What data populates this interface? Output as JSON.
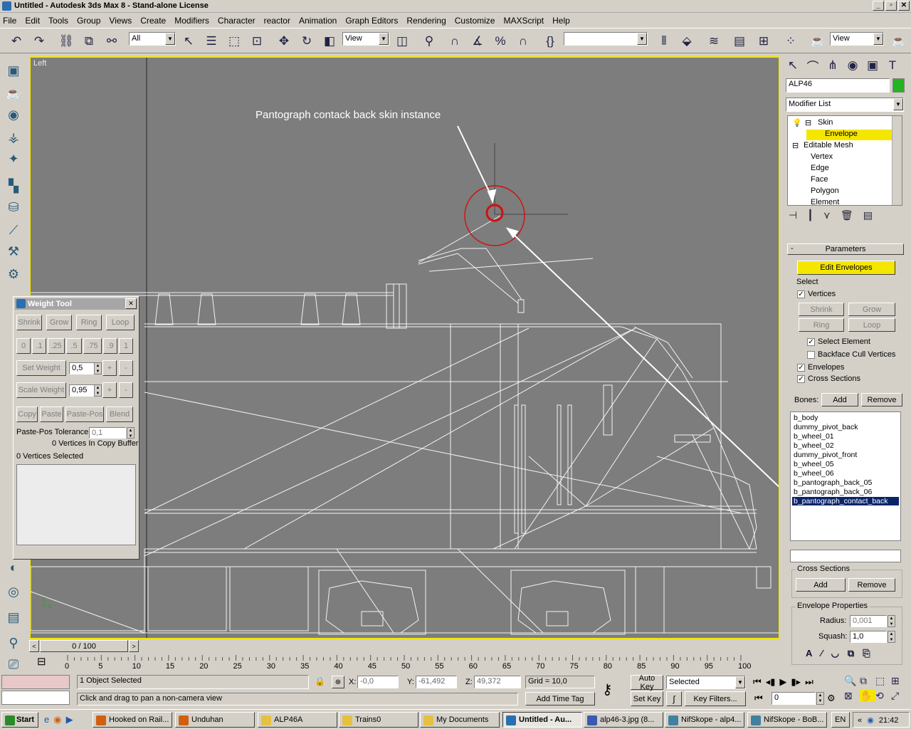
{
  "window": {
    "title": "Untitled - Autodesk 3ds Max 8  - Stand-alone License"
  },
  "menu": [
    "File",
    "Edit",
    "Tools",
    "Group",
    "Views",
    "Create",
    "Modifiers",
    "Character",
    "reactor",
    "Animation",
    "Graph Editors",
    "Rendering",
    "Customize",
    "MAXScript",
    "Help"
  ],
  "toolbar": {
    "selection_filter": "All",
    "ref_coord": "View",
    "named_sel": "",
    "render_view": "View"
  },
  "viewport": {
    "label": "Left",
    "annotation": "Pantograph contack back skin instance"
  },
  "command_panel": {
    "object_name": "ALP46",
    "object_color": "#22b422",
    "modifier_list": "Modifier List",
    "stack": [
      {
        "label": "Skin",
        "sym": "⊟"
      },
      {
        "label": "Envelope",
        "selected": true
      },
      {
        "label": "Editable Mesh",
        "sym": "⊟"
      },
      {
        "label": "Vertex"
      },
      {
        "label": "Edge"
      },
      {
        "label": "Face"
      },
      {
        "label": "Polygon"
      },
      {
        "label": "Element"
      }
    ],
    "rollout_title": "Parameters",
    "rollout_collapse": "-",
    "edit_envelopes": "Edit Envelopes",
    "select_label": "Select",
    "vertices": "Vertices",
    "shrink": "Shrink",
    "grow": "Grow",
    "ring": "Ring",
    "loop": "Loop",
    "select_element": "Select Element",
    "backface_cull": "Backface Cull Vertices",
    "envelopes": "Envelopes",
    "cross_sections": "Cross Sections",
    "bones_label": "Bones:",
    "add": "Add",
    "remove": "Remove",
    "bones": [
      "b_body",
      "dummy_pivot_back",
      "b_wheel_01",
      "b_wheel_02",
      "dummy_pivot_front",
      "b_wheel_05",
      "b_wheel_06",
      "b_pantograph_back_05",
      "b_pantograph_back_06",
      "b_pantograph_contact_back"
    ],
    "cross_sections_group": "Cross Sections",
    "cs_add": "Add",
    "cs_remove": "Remove",
    "envelope_props": "Envelope Properties",
    "radius_label": "Radius:",
    "radius": "0,001",
    "squash_label": "Squash:",
    "squash": "1,0"
  },
  "weight_tool": {
    "title": "Weight Tool",
    "close": "✕",
    "shrink": "Shrink",
    "grow": "Grow",
    "ring": "Ring",
    "loop": "Loop",
    "presets": [
      "0",
      ".1",
      ".25",
      ".5",
      ".75",
      ".9",
      "1"
    ],
    "set_weight": "Set Weight",
    "set_weight_val": "0,5",
    "scale_weight": "Scale Weight",
    "scale_weight_val": "0,95",
    "plus": "+",
    "minus": "-",
    "copy": "Copy",
    "paste": "Paste",
    "paste_pos": "Paste-Pos",
    "blend": "Blend",
    "tolerance_label": "Paste-Pos Tolerance",
    "tolerance": "0,1",
    "copy_buffer": "0 Vertices In Copy Buffer",
    "verts_selected": "0 Vertices Selected"
  },
  "timeline": {
    "position": "0 / 100",
    "ticks": [
      "0",
      "5",
      "10",
      "15",
      "20",
      "25",
      "30",
      "35",
      "40",
      "45",
      "50",
      "55",
      "60",
      "65",
      "70",
      "75",
      "80",
      "85",
      "90",
      "95",
      "100"
    ]
  },
  "status": {
    "selected": "1 Object Selected",
    "prompt": "Click and drag to pan a non-camera view",
    "x_label": "X:",
    "x": "-0,0",
    "y_label": "Y:",
    "y": "-61,492",
    "z_label": "Z:",
    "z": "49,372",
    "grid": "Grid = 10,0",
    "add_time_tag": "Add Time Tag",
    "auto_key": "Auto Key",
    "set_key": "Set Key",
    "key_mode": "Selected",
    "key_filters": "Key Filters...",
    "frame": "0"
  },
  "taskbar": {
    "start": "Start",
    "tasks": [
      "Hooked on Rail...",
      "Unduhan",
      "ALP46A",
      "Trains0",
      "My Documents",
      "Untitled - Au...",
      "alp46-3.jpg (8...",
      "NifSkope - alp4...",
      "NifSkope - BoB..."
    ],
    "lang": "EN",
    "chevron": "«",
    "time": "21:42"
  }
}
